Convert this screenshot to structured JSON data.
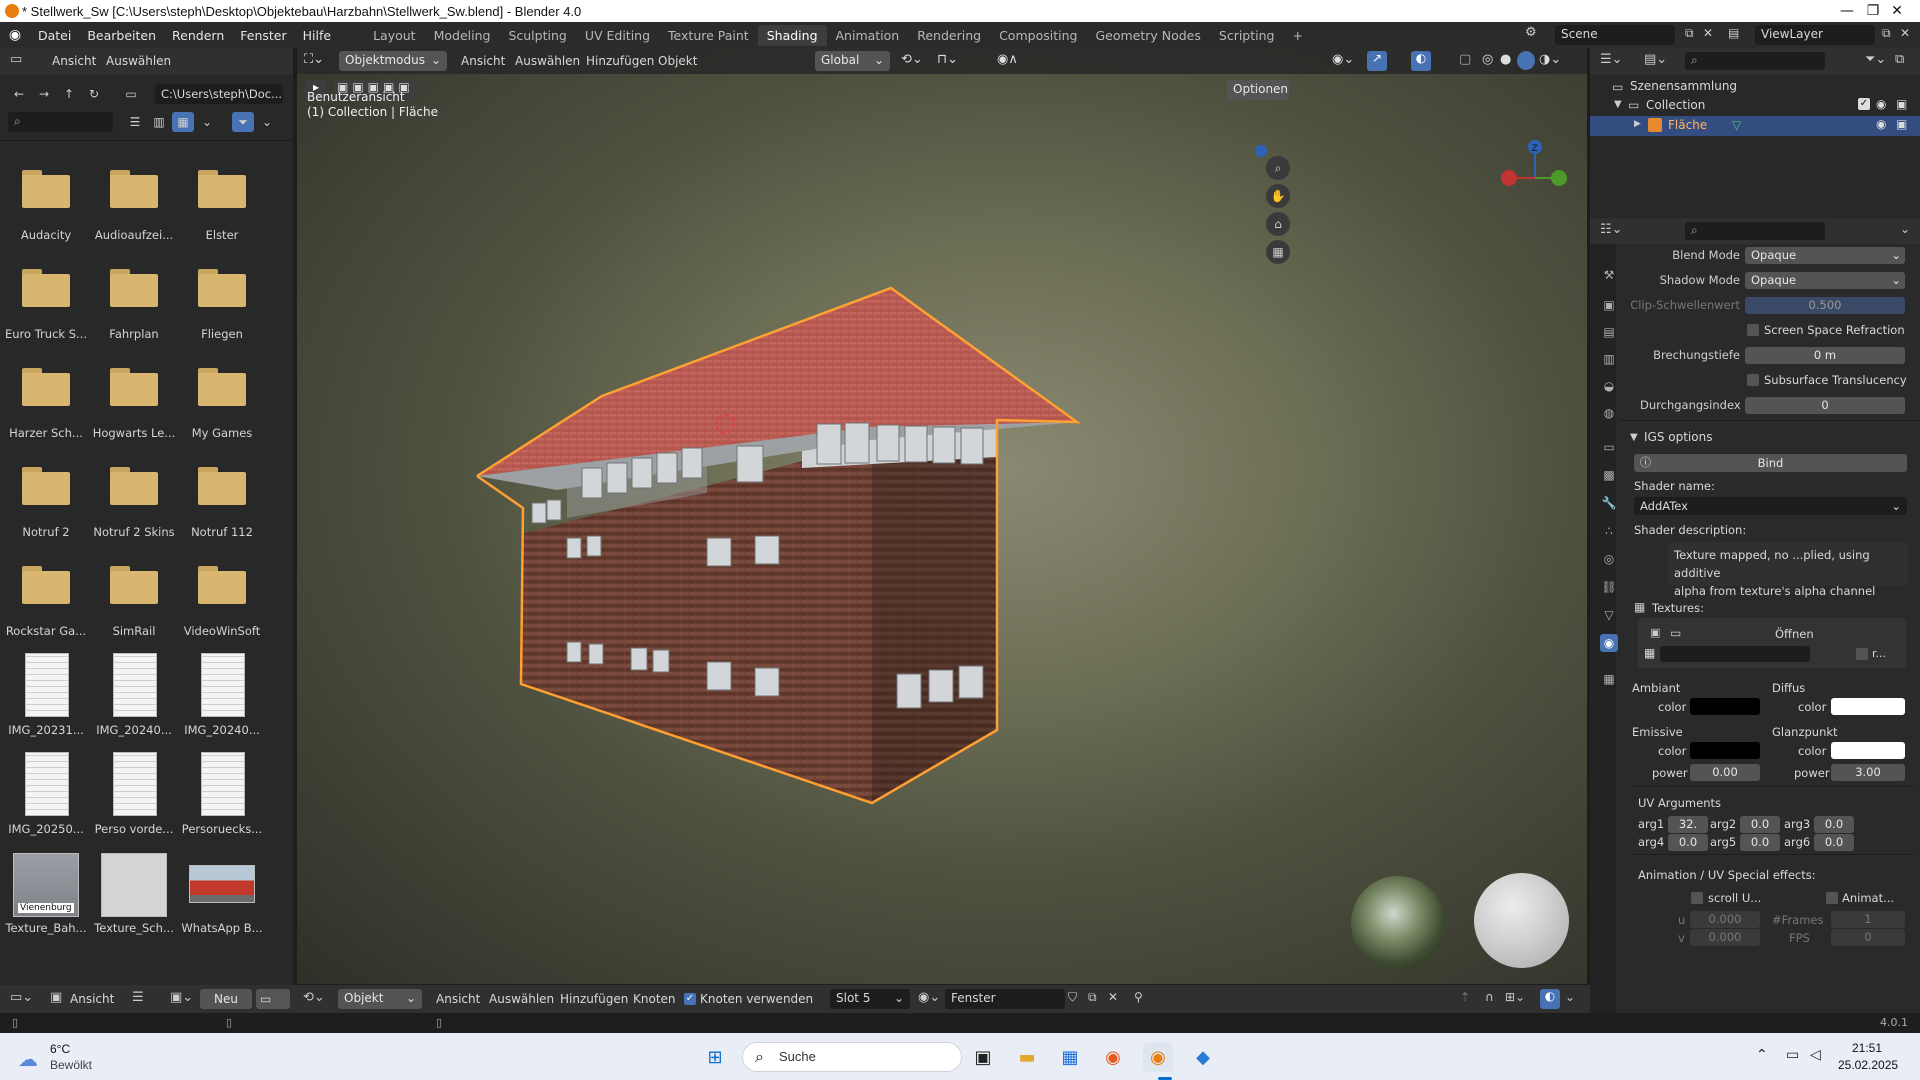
{
  "window": {
    "title": "* Stellwerk_Sw [C:\\Users\\steph\\Desktop\\Objektebau\\Harzbahn\\Stellwerk_Sw.blend] - Blender 4.0",
    "minimize": "—",
    "maximize": "❐",
    "close": "✕"
  },
  "menu": [
    "Datei",
    "Bearbeiten",
    "Rendern",
    "Fenster",
    "Hilfe"
  ],
  "workspaces": [
    "Layout",
    "Modeling",
    "Sculpting",
    "UV Editing",
    "Texture Paint",
    "Shading",
    "Animation",
    "Rendering",
    "Compositing",
    "Geometry Nodes",
    "Scripting"
  ],
  "active_workspace": "Shading",
  "add_workspace": "+",
  "scene": {
    "label": "Scene",
    "view_layer": "ViewLayer"
  },
  "filebrowser": {
    "header": {
      "ansicht": "Ansicht",
      "auswaehlen": "Auswählen"
    },
    "path": "C:\\Users\\steph\\Doc...",
    "items": [
      {
        "name": "Audacity",
        "kind": "folder"
      },
      {
        "name": "Audioaufzei...",
        "kind": "folder"
      },
      {
        "name": "Elster",
        "kind": "folder"
      },
      {
        "name": "Euro Truck S...",
        "kind": "folder"
      },
      {
        "name": "Fahrplan",
        "kind": "folder"
      },
      {
        "name": "Fliegen",
        "kind": "folder"
      },
      {
        "name": "Harzer Sch...",
        "kind": "folder"
      },
      {
        "name": "Hogwarts Le...",
        "kind": "folder"
      },
      {
        "name": "My Games",
        "kind": "folder"
      },
      {
        "name": "Notruf 2",
        "kind": "folder"
      },
      {
        "name": "Notruf 2 Skins",
        "kind": "folder"
      },
      {
        "name": "Notruf 112",
        "kind": "folder"
      },
      {
        "name": "Rockstar Ga...",
        "kind": "folder"
      },
      {
        "name": "SimRail",
        "kind": "folder"
      },
      {
        "name": "VideoWinSoft",
        "kind": "folder"
      },
      {
        "name": "IMG_20231...",
        "kind": "doc"
      },
      {
        "name": "IMG_20240...",
        "kind": "doc"
      },
      {
        "name": "IMG_20240...",
        "kind": "doc"
      },
      {
        "name": "IMG_20250...",
        "kind": "doc"
      },
      {
        "name": "Perso vorde...",
        "kind": "doc"
      },
      {
        "name": "Persoruecks...",
        "kind": "doc"
      },
      {
        "name": "Texture_Bah...",
        "kind": "image"
      },
      {
        "name": "Texture_Sch...",
        "kind": "image"
      },
      {
        "name": "WhatsApp B...",
        "kind": "photo"
      }
    ],
    "thumb_overlay_text": "Vienenburg"
  },
  "viewport": {
    "mode": "Objektmodus",
    "menus": [
      "Ansicht",
      "Auswählen",
      "Hinzufügen",
      "Objekt"
    ],
    "transform": "Global",
    "options": "Optionen",
    "view_name": "Benutzeransicht",
    "collection_info": "(1) Collection | Fläche",
    "gizmo_z": "Z"
  },
  "outliner": {
    "root": "Szenensammlung",
    "collection": "Collection",
    "object": "Fläche"
  },
  "properties": {
    "blend_mode_label": "Blend Mode",
    "blend_mode_value": "Opaque",
    "shadow_mode_label": "Shadow Mode",
    "shadow_mode_value": "Opaque",
    "clip_label": "Clip-Schwellenwert",
    "clip_value": "0.500",
    "ssr_label": "Screen Space Refraction",
    "brechung_label": "Brechungstiefe",
    "brechung_value": "0 m",
    "sss_label": "Subsurface Translucency",
    "durchgang_label": "Durchgangsindex",
    "durchgang_value": "0",
    "igs_title": "IGS options",
    "bind": "Bind",
    "shader_name_label": "Shader name:",
    "shader_name_value": "AddATex",
    "shader_desc_label": "Shader description:",
    "shader_desc_line1": "Texture mapped, no ...plied, using additive",
    "shader_desc_line2": "alpha from texture's alpha channel",
    "textures_label": "Textures:",
    "open_label": "Öffnen",
    "tex_r": "r...",
    "ambiant": "Ambiant",
    "diffus": "Diffus",
    "emissive": "Emissive",
    "glanzpunkt": "Glanzpunkt",
    "color": "color",
    "power": "power",
    "emissive_power": "0.00",
    "glanz_power": "3.00",
    "ambiant_color": "#000000",
    "diffus_color": "#ffffff",
    "emissive_color": "#000000",
    "glanz_color": "#ffffff",
    "uv_title": "UV Arguments",
    "uv_args": [
      {
        "label": "arg1",
        "value": "32."
      },
      {
        "label": "arg2",
        "value": "0.0"
      },
      {
        "label": "arg3",
        "value": "0.0"
      },
      {
        "label": "arg4",
        "value": "0.0"
      },
      {
        "label": "arg5",
        "value": "0.0"
      },
      {
        "label": "arg6",
        "value": "0.0"
      }
    ],
    "anim_title": "Animation / UV Special effects:",
    "scroll_label": "scroll U...",
    "animat_label": "Animat...",
    "u_label": "u",
    "v_label": "v",
    "u_value": "0.000",
    "v_value": "0.000",
    "frames_label": "#Frames",
    "frames_value": "1",
    "fps_label": "FPS",
    "fps_value": "0"
  },
  "node_header": {
    "ansicht": "Ansicht",
    "neu": "Neu",
    "objekt": "Objekt",
    "menus": [
      "Ansicht",
      "Auswählen",
      "Hinzufügen",
      "Knoten"
    ],
    "use_nodes": "Knoten verwenden",
    "slot": "Slot 5",
    "material": "Fenster"
  },
  "status": {
    "version": "4.0.1"
  },
  "taskbar": {
    "temp": "6°C",
    "weather": "Bewölkt",
    "search": "Suche",
    "time": "21:51",
    "date": "25.02.2025"
  },
  "colors": {
    "accent": "#4772b3",
    "selection": "#ffa033",
    "roof": "#b5574f",
    "brick": "#6a3e32"
  }
}
